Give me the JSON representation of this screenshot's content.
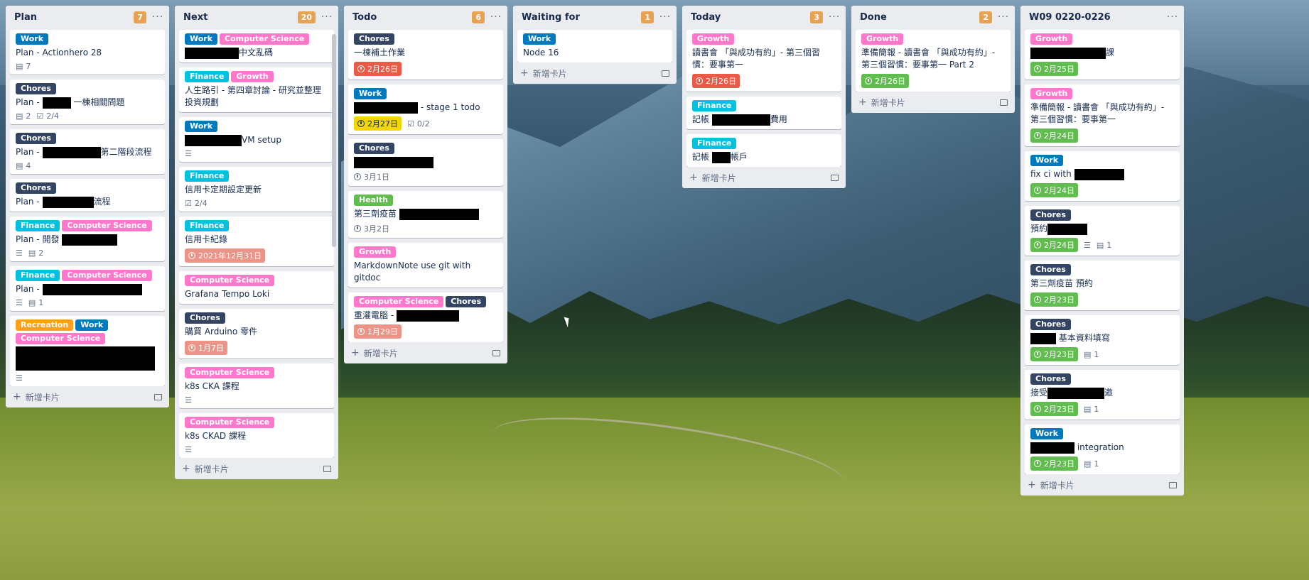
{
  "colors": {
    "Work": "#0079bf",
    "Computer Science": "#ff78cb",
    "Chores": "#344563",
    "Finance": "#00c2e0",
    "Growth": "#ff78cb",
    "Health": "#61bd4f",
    "Recreation": "#ff9f1a",
    "due_red": "#eb5a46",
    "due_pink": "#ec9488",
    "due_yellow": "#f2d600",
    "due_green": "#61bd4f",
    "count": "#e6a153"
  },
  "add_card_label": "新增卡片",
  "lists": [
    {
      "title": "Plan",
      "count": "7",
      "cards": [
        {
          "labels": [
            "Work"
          ],
          "title": "Plan - Actionhero 28",
          "badges": [
            {
              "icon": "checklist-icon",
              "text": "7"
            }
          ]
        },
        {
          "labels": [
            "Chores"
          ],
          "title_pre": "Plan - ",
          "redact": 40,
          "title_post": " 一棟相關問題",
          "badges": [
            {
              "icon": "checklist-icon",
              "text": "2"
            },
            {
              "icon": "checkbox-icon",
              "text": "2/4"
            }
          ]
        },
        {
          "labels": [
            "Chores"
          ],
          "title_pre": "Plan - ",
          "redact": 82,
          "title_post": "第二階段流程",
          "badges": [
            {
              "icon": "checklist-icon",
              "text": "4"
            }
          ]
        },
        {
          "labels": [
            "Chores"
          ],
          "title_pre": "Plan - ",
          "redact": 72,
          "title_post": "流程",
          "badges": []
        },
        {
          "labels": [
            "Finance",
            "Computer Science"
          ],
          "title_pre": "Plan - 開發 ",
          "redact": 78,
          "title_post": "",
          "badges": [
            {
              "icon": "description-icon",
              "text": ""
            },
            {
              "icon": "checklist-icon",
              "text": "2"
            }
          ]
        },
        {
          "labels": [
            "Finance",
            "Computer Science"
          ],
          "title_pre": "Plan - ",
          "redact": 140,
          "title_post": "",
          "badges": [
            {
              "icon": "description-icon",
              "text": ""
            },
            {
              "icon": "checklist-icon",
              "text": "1"
            }
          ]
        },
        {
          "labels": [
            "Recreation",
            "Work",
            "Computer Science"
          ],
          "title_pre": "",
          "redact": 196,
          "redact_h": 34,
          "title_post": "",
          "badges": [
            {
              "icon": "description-icon",
              "text": ""
            }
          ]
        }
      ]
    },
    {
      "title": "Next",
      "count": "20",
      "cards": [
        {
          "labels": [
            "Work",
            "Computer Science"
          ],
          "title_pre": "",
          "redact": 76,
          "title_post": "中文亂碼",
          "badges": []
        },
        {
          "labels": [
            "Finance",
            "Growth"
          ],
          "title": "人生路引 - 第四章討論 - 研究並整理投資規劃",
          "badges": []
        },
        {
          "labels": [
            "Work"
          ],
          "title_pre": "",
          "redact": 80,
          "title_post": "VM setup",
          "badges": [
            {
              "icon": "description-icon",
              "text": ""
            }
          ]
        },
        {
          "labels": [
            "Finance"
          ],
          "title": "信用卡定期設定更新",
          "badges": [
            {
              "icon": "checkbox-icon",
              "text": "2/4"
            }
          ]
        },
        {
          "labels": [
            "Finance"
          ],
          "title": "信用卡紀錄",
          "due": {
            "text": "2021年12月31日",
            "color": "due_pink"
          },
          "badges": []
        },
        {
          "labels": [
            "Computer Science"
          ],
          "title": "Grafana Tempo Loki",
          "badges": []
        },
        {
          "labels": [
            "Chores"
          ],
          "title": "購買 Arduino 零件",
          "due": {
            "text": "1月7日",
            "color": "due_pink"
          },
          "badges": []
        },
        {
          "labels": [
            "Computer Science"
          ],
          "title": "k8s CKA 課程",
          "badges": [
            {
              "icon": "description-icon",
              "text": ""
            }
          ]
        },
        {
          "labels": [
            "Computer Science"
          ],
          "title": "k8s CKAD 課程",
          "badges": [
            {
              "icon": "description-icon",
              "text": ""
            }
          ]
        }
      ]
    },
    {
      "title": "Todo",
      "count": "6",
      "cards": [
        {
          "labels": [
            "Chores"
          ],
          "title": "一棟補土作業",
          "due": {
            "text": "2月26日",
            "color": "due_red"
          },
          "badges": []
        },
        {
          "labels": [
            "Work"
          ],
          "title_pre": "",
          "redact": 90,
          "title_post": " - stage 1 todo",
          "due": {
            "text": "2月27日",
            "color": "due_yellow"
          },
          "badges": [
            {
              "icon": "checkbox-icon",
              "text": "0/2"
            }
          ]
        },
        {
          "labels": [
            "Chores"
          ],
          "title_pre": "",
          "redact": 112,
          "title_post": "",
          "badges": [
            {
              "icon": "clock-icon",
              "text": "3月1日"
            }
          ]
        },
        {
          "labels": [
            "Health"
          ],
          "title_pre": "第三劑疫苗 ",
          "redact": 112,
          "title_post": "",
          "badges": [
            {
              "icon": "clock-icon",
              "text": "3月2日"
            }
          ]
        },
        {
          "labels": [
            "Growth"
          ],
          "title": "MarkdownNote use git with gitdoc",
          "badges": []
        },
        {
          "labels": [
            "Computer Science",
            "Chores"
          ],
          "title_pre": "重灌電腦 - ",
          "redact": 88,
          "title_post": "",
          "due": {
            "text": "1月29日",
            "color": "due_pink"
          },
          "badges": []
        }
      ]
    },
    {
      "title": "Waiting for",
      "count": "1",
      "cards": [
        {
          "labels": [
            "Work"
          ],
          "title": "Node 16",
          "badges": []
        }
      ]
    },
    {
      "title": "Today",
      "count": "3",
      "cards": [
        {
          "labels": [
            "Growth"
          ],
          "title": "讀書會 「與成功有約」- 第三個習慣：要事第一",
          "due": {
            "text": "2月26日",
            "color": "due_red"
          },
          "badges": []
        },
        {
          "labels": [
            "Finance"
          ],
          "title_pre": "記帳 ",
          "redact": 82,
          "title_post": "費用",
          "badges": []
        },
        {
          "labels": [
            "Finance"
          ],
          "title_pre": "記帳 ",
          "redact": 26,
          "title_post": "帳戶",
          "badges": []
        }
      ]
    },
    {
      "title": "Done",
      "count": "2",
      "cards": [
        {
          "labels": [
            "Growth"
          ],
          "title": "準備簡報 - 讀書會 「與成功有約」- 第三個習慣：要事第一 Part 2",
          "due": {
            "text": "2月26日",
            "color": "due_green"
          },
          "badges": []
        }
      ]
    },
    {
      "title": "W09 0220-0226",
      "count": "",
      "cards": [
        {
          "labels": [
            "Growth"
          ],
          "title_pre": "",
          "redact": 106,
          "title_post": "課",
          "due": {
            "text": "2月25日",
            "color": "due_green"
          },
          "badges": []
        },
        {
          "labels": [
            "Growth"
          ],
          "title": "準備簡報 - 讀書會 「與成功有約」- 第三個習慣：要事第一",
          "due": {
            "text": "2月24日",
            "color": "due_green"
          },
          "badges": []
        },
        {
          "labels": [
            "Work"
          ],
          "title_pre": "fix ci with ",
          "redact": 70,
          "title_post": "",
          "due": {
            "text": "2月24日",
            "color": "due_green"
          },
          "badges": []
        },
        {
          "labels": [
            "Chores"
          ],
          "title_pre": "預約",
          "redact": 56,
          "title_post": "",
          "due": {
            "text": "2月24日",
            "color": "due_green"
          },
          "badges": [
            {
              "icon": "description-icon",
              "text": ""
            },
            {
              "icon": "checklist-icon",
              "text": "1"
            }
          ]
        },
        {
          "labels": [
            "Chores"
          ],
          "title": "第三劑疫苗 預約",
          "due": {
            "text": "2月23日",
            "color": "due_green"
          },
          "badges": []
        },
        {
          "labels": [
            "Chores"
          ],
          "title_pre": "",
          "redact": 36,
          "title_post": " 基本資料填寫",
          "due": {
            "text": "2月23日",
            "color": "due_green"
          },
          "badges": [
            {
              "icon": "checklist-icon",
              "text": "1"
            }
          ]
        },
        {
          "labels": [
            "Chores"
          ],
          "title_pre": "接受",
          "redact": 80,
          "title_post": "邀",
          "due": {
            "text": "2月23日",
            "color": "due_green"
          },
          "badges": [
            {
              "icon": "checklist-icon",
              "text": "1"
            }
          ]
        },
        {
          "labels": [
            "Work"
          ],
          "title_pre": "",
          "redact": 62,
          "title_post": " integration",
          "due": {
            "text": "2月23日",
            "color": "due_green"
          },
          "badges": [
            {
              "icon": "checklist-icon",
              "text": "1"
            }
          ]
        }
      ]
    }
  ]
}
